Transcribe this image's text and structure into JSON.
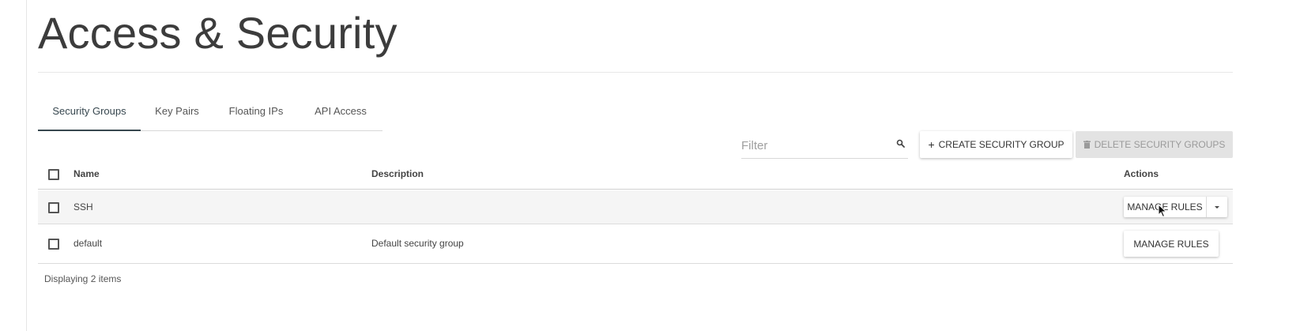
{
  "page": {
    "title": "Access & Security"
  },
  "tabs": [
    {
      "label": "Security Groups",
      "active": true
    },
    {
      "label": "Key Pairs",
      "active": false
    },
    {
      "label": "Floating IPs",
      "active": false
    },
    {
      "label": "API Access",
      "active": false
    }
  ],
  "toolbar": {
    "filter_placeholder": "Filter",
    "create_label": "CREATE SECURITY GROUP",
    "delete_label": "DELETE SECURITY GROUPS",
    "create_icon": "plus-icon",
    "delete_icon": "trash-icon",
    "search_icon": "search-icon"
  },
  "table": {
    "columns": {
      "name": "Name",
      "description": "Description",
      "actions": "Actions"
    },
    "rows": [
      {
        "name": "SSH",
        "description": "",
        "action_label": "MANAGE RULES",
        "has_dropdown": true,
        "hovered": true
      },
      {
        "name": "default",
        "description": "Default security group",
        "action_label": "MANAGE RULES",
        "has_dropdown": false,
        "hovered": false
      }
    ],
    "footer": "Displaying 2 items"
  },
  "colors": {
    "title": "#3c3c3c",
    "tab_active": "#37474f",
    "row_hover": "#f5f5f5",
    "disabled_button": "#e3e3e3"
  }
}
